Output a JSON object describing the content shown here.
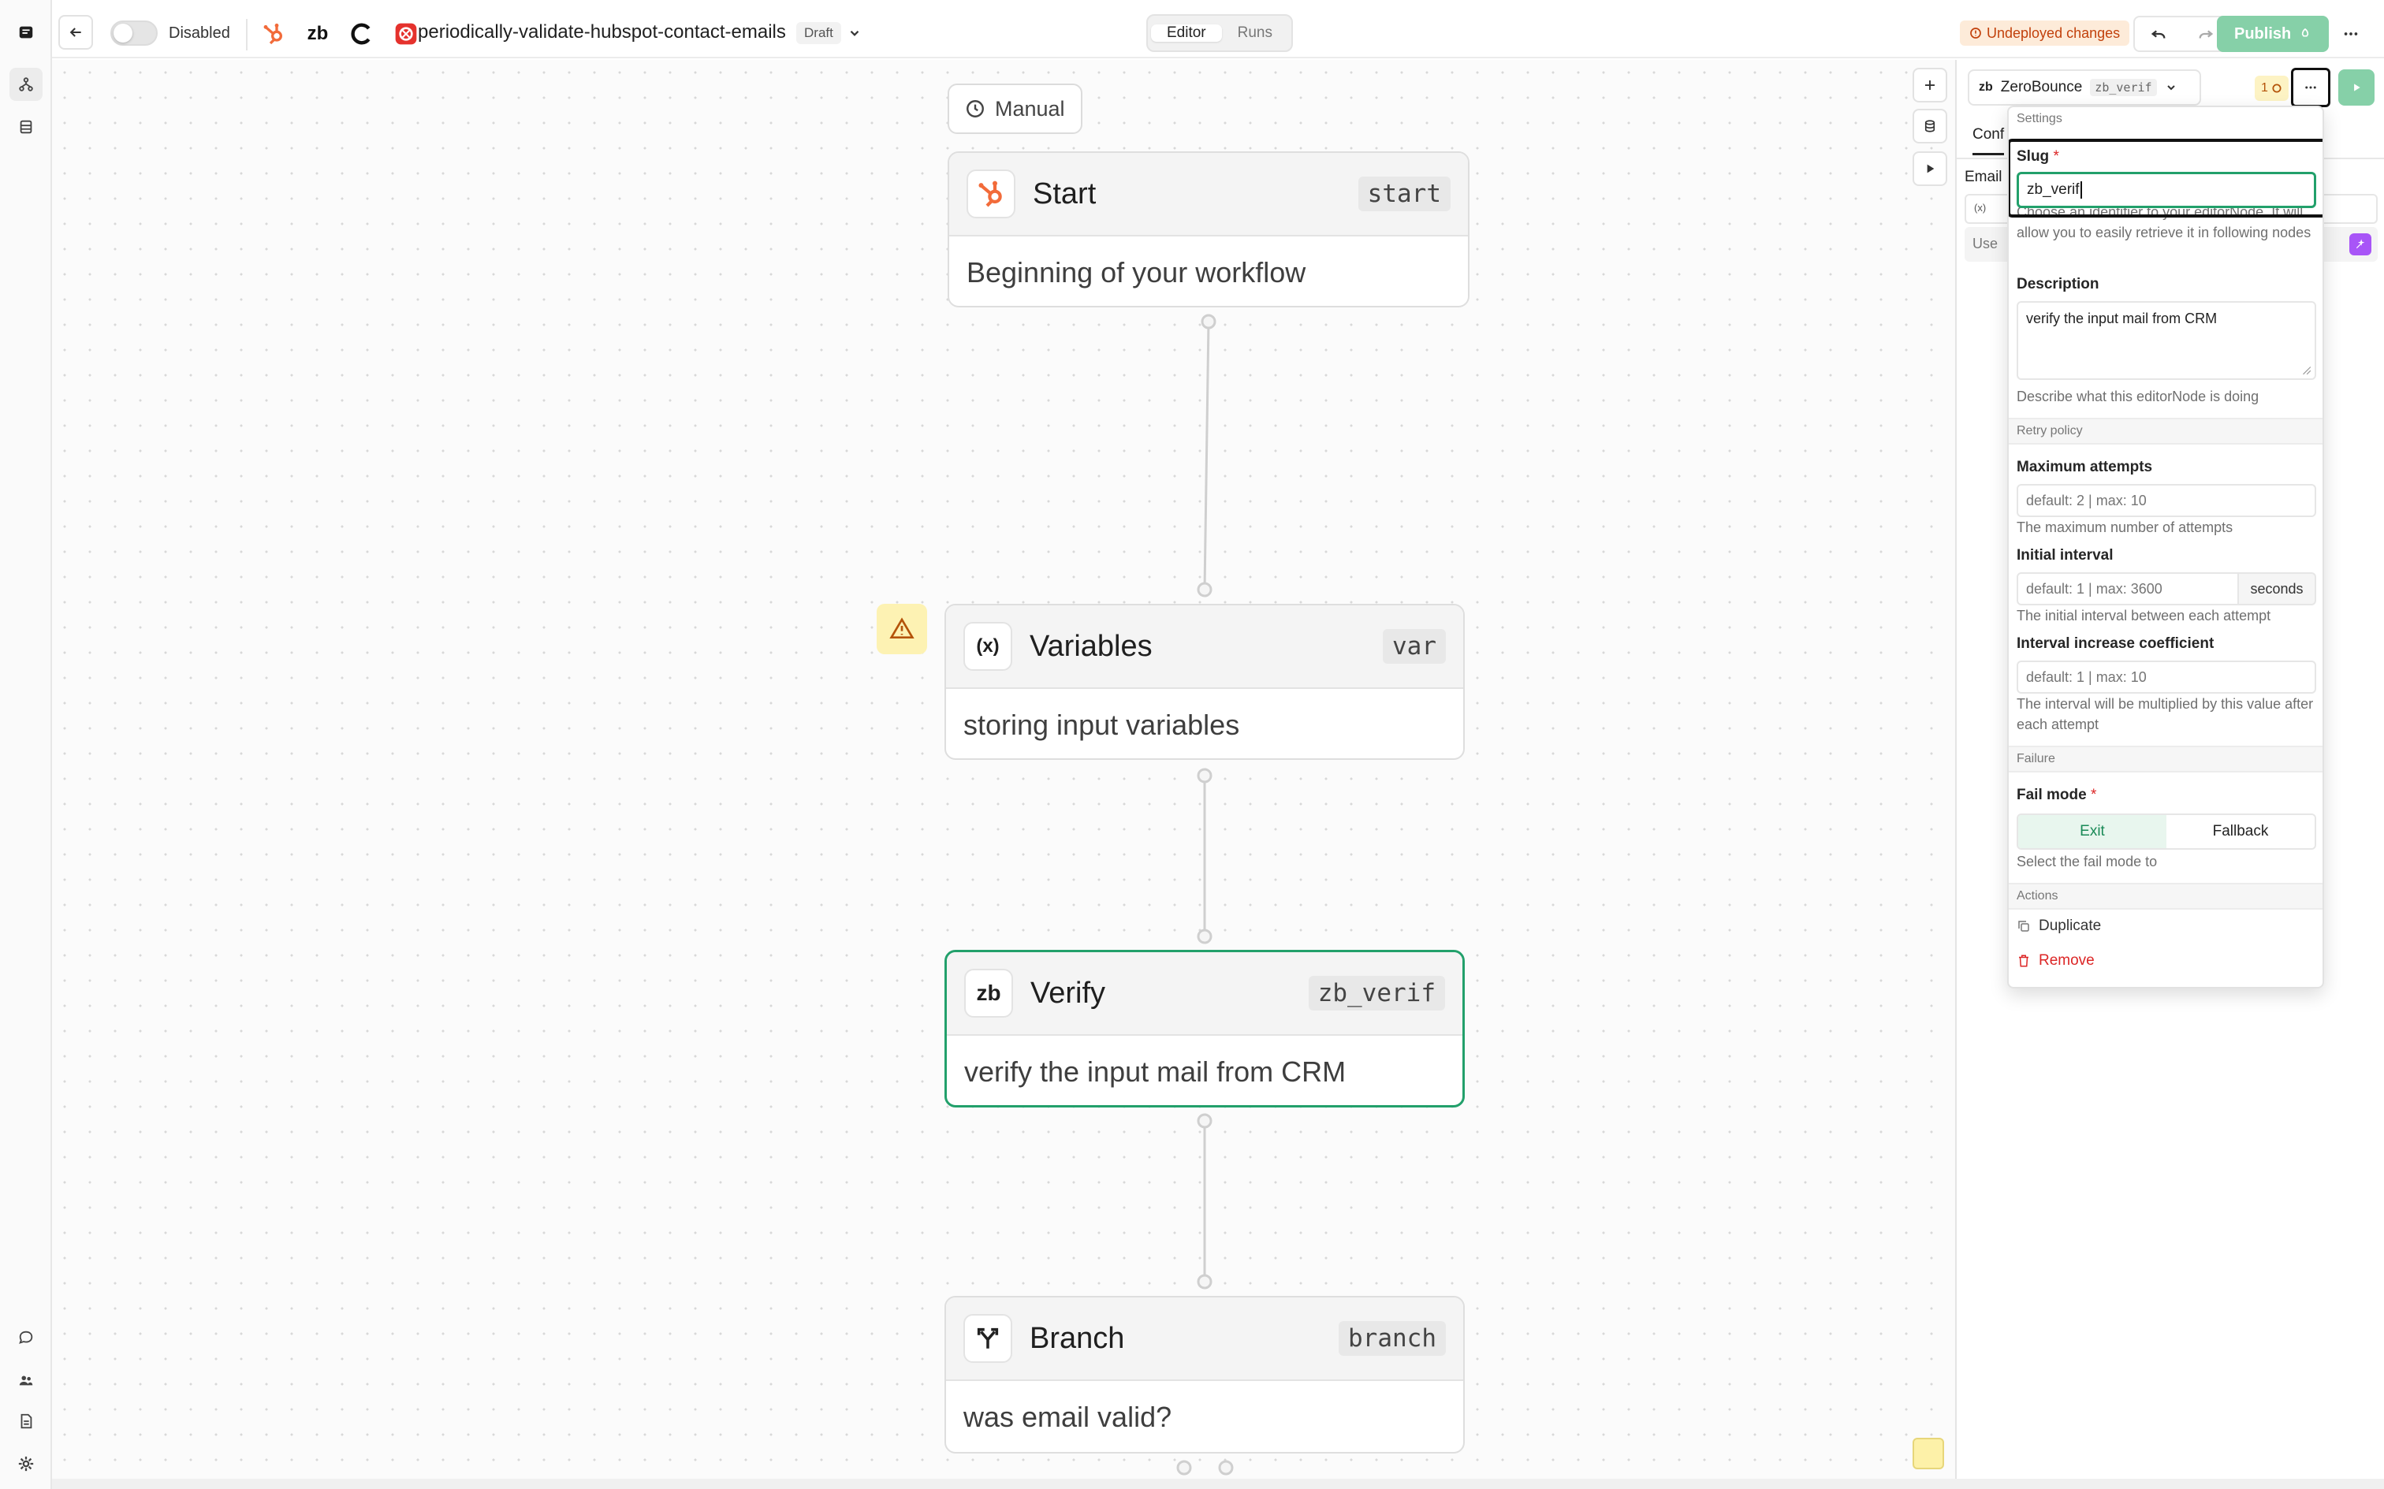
{
  "topbar": {
    "toggle_label": "Disabled",
    "integration_zb_label": "zb",
    "workflow_title": "periodically-validate-hubspot-contact-emails",
    "status_badge": "Draft",
    "tabs": [
      {
        "label": "Editor",
        "active": true
      },
      {
        "label": "Runs",
        "active": false
      }
    ],
    "undeployed_label": "Undeployed changes",
    "publish_label": "Publish"
  },
  "canvas": {
    "trigger_label": "Manual",
    "nodes": [
      {
        "title": "Start",
        "slug": "start",
        "description": "Beginning of your workflow",
        "icon": "hubspot-icon"
      },
      {
        "title": "Variables",
        "slug": "var",
        "description": "storing input variables",
        "icon": "variables-icon",
        "icon_text": "(x)"
      },
      {
        "title": "Verify",
        "slug": "zb_verif",
        "description": "verify the input mail from CRM",
        "icon": "zerobounce-icon",
        "icon_text": "zb"
      },
      {
        "title": "Branch",
        "slug": "branch",
        "description": "was email valid?",
        "icon": "branch-icon"
      }
    ]
  },
  "panel": {
    "node_name": "ZeroBounce",
    "node_icon_text": "zb",
    "node_slug": "zb_verif",
    "credits_badge": "1",
    "tab_partial": "Conf",
    "field_partial": "Email",
    "var_chip": "(x)",
    "use_partial": "Use"
  },
  "settings": {
    "header": "Settings",
    "slug_label": "Slug",
    "slug_value": "zb_verif",
    "slug_help": "Choose an identifier to your editorNode. It will allow you to easily retrieve it in following nodes",
    "description_label": "Description",
    "description_value": "verify the input mail from CRM",
    "description_help": "Describe what this editorNode is doing",
    "retry_header": "Retry policy",
    "max_attempts_label": "Maximum attempts",
    "max_attempts_placeholder": "default: 2 | max: 10",
    "max_attempts_help": "The maximum number of attempts",
    "initial_interval_label": "Initial interval",
    "initial_interval_placeholder": "default: 1 | max: 3600",
    "initial_interval_unit": "seconds",
    "initial_interval_help": "The initial interval between each attempt",
    "coef_label": "Interval increase coefficient",
    "coef_placeholder": "default: 1 | max: 10",
    "coef_help": "The interval will be multiplied by this value after each attempt",
    "failure_header": "Failure",
    "fail_mode_label": "Fail mode",
    "fail_modes": [
      "Exit",
      "Fallback"
    ],
    "fail_mode_selected": "Exit",
    "fail_mode_help": "Select the fail mode to",
    "actions_header": "Actions",
    "duplicate_label": "Duplicate",
    "remove_label": "Remove"
  },
  "colors": {
    "accent_green": "#22a06b",
    "publish_green": "#86d0a8",
    "warning_orange": "#c2410c",
    "danger_red": "#dc2626",
    "hubspot_orange": "#f26b3a"
  }
}
